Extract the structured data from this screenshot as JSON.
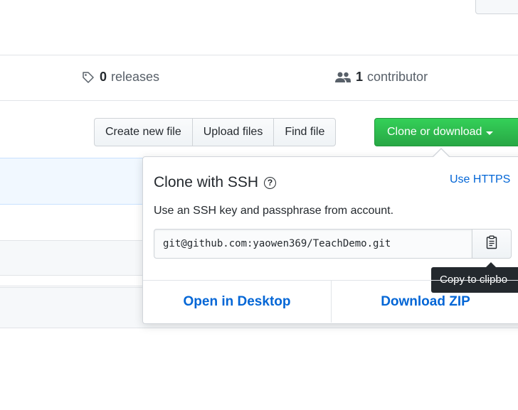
{
  "summary": {
    "releases_count": "0",
    "releases_label": "releases",
    "contributors_count": "1",
    "contributors_label": "contributor"
  },
  "toolbar": {
    "create_new_file": "Create new file",
    "upload_files": "Upload files",
    "find_file": "Find file",
    "clone_or_download": "Clone or download"
  },
  "clone_panel": {
    "title": "Clone with SSH",
    "help_glyph": "?",
    "switch_link": "Use HTTPS",
    "description": "Use an SSH key and passphrase from account.",
    "url": "git@github.com:yaowen369/TeachDemo.git",
    "copy_tooltip": "Copy to clipbo",
    "open_desktop": "Open in Desktop",
    "download_zip": "Download ZIP"
  },
  "colors": {
    "primary_green": "#28a745",
    "link_blue": "#0366d6",
    "tooltip_bg": "#24292e"
  }
}
